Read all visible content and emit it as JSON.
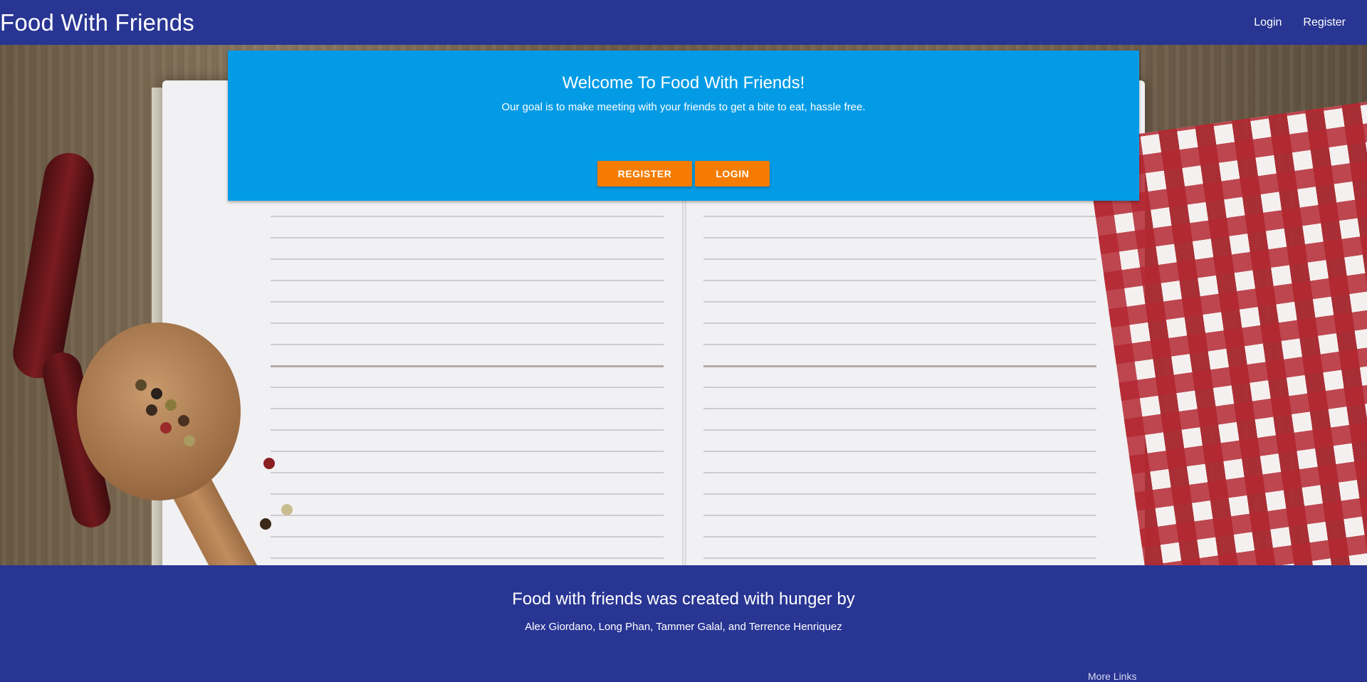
{
  "navbar": {
    "brand": "Food With Friends",
    "links": [
      "Login",
      "Register"
    ]
  },
  "welcome": {
    "title": "Welcome To Food With Friends!",
    "subtitle": "Our goal is to make meeting with your friends to get a bite to eat, hassle free.",
    "register_button": "REGISTER",
    "login_button": "LOGIN"
  },
  "footer": {
    "title": "Food with friends was created with hunger by",
    "names": "Alex Giordano, Long Phan, Tammer Galal, and Terrence Henriquez",
    "more_links": "More Links"
  },
  "colors": {
    "navbar": "#283593",
    "card": "#039be5",
    "button": "#f57c00"
  }
}
